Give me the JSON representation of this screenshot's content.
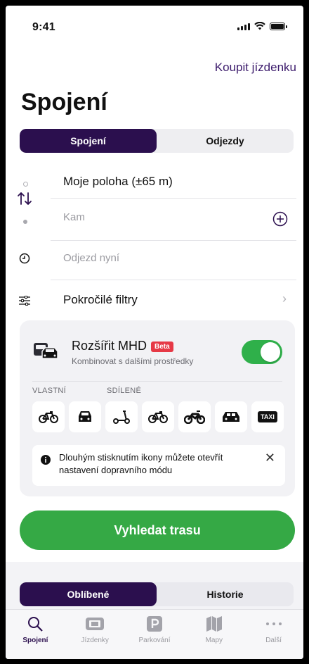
{
  "status_bar": {
    "time": "9:41"
  },
  "header": {
    "buy_ticket": "Koupit jízdenku",
    "title": "Spojení"
  },
  "top_segment": {
    "tabs": [
      {
        "label": "Spojení"
      },
      {
        "label": "Odjezdy"
      }
    ],
    "active": 0
  },
  "route": {
    "from": "Moje poloha (±65 m)",
    "to_placeholder": "Kam",
    "time_placeholder": "Odjezd nyní",
    "filters": "Pokročilé filtry"
  },
  "extend_card": {
    "title": "Rozšířit MHD",
    "badge": "Beta",
    "subtitle": "Kombinovat s dalšími prostředky",
    "toggle_on": true,
    "own_label": "VLASTNÍ",
    "shared_label": "SDÍLENÉ",
    "modes": [
      {
        "icon": "bicycle-icon"
      },
      {
        "icon": "car-icon"
      },
      {
        "icon": "scooter-icon"
      },
      {
        "icon": "shared-bicycle-icon"
      },
      {
        "icon": "motorbike-icon"
      },
      {
        "icon": "shared-car-icon"
      },
      {
        "icon": "taxi-icon",
        "label": "TAXI"
      }
    ],
    "tip": "Dlouhým stisknutím ikony můžete otevřít nastavení dopravního módu"
  },
  "search_button": "Vyhledat trasu",
  "bottom_segment": {
    "tabs": [
      {
        "label": "Oblíbené"
      },
      {
        "label": "Historie"
      }
    ],
    "active": 0
  },
  "tab_bar": [
    {
      "label": "Spojení",
      "icon": "search-icon",
      "active": true
    },
    {
      "label": "Jízdenky",
      "icon": "ticket-icon"
    },
    {
      "label": "Parkování",
      "icon": "parking-icon"
    },
    {
      "label": "Mapy",
      "icon": "map-icon"
    },
    {
      "label": "Další",
      "icon": "more-icon"
    }
  ],
  "colors": {
    "brand": "#2b0f4e",
    "accent_green": "#35a945",
    "badge_red": "#e63946"
  }
}
